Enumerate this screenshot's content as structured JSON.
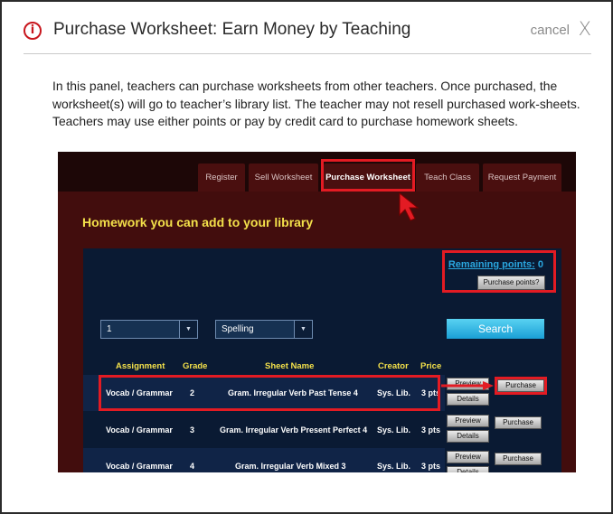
{
  "dialog": {
    "title": "Purchase Worksheet: Earn Money by Teaching",
    "cancel_label": "cancel",
    "close_glyph": "X",
    "info_glyph": "i",
    "description": "In this panel, teachers can purchase worksheets from other teachers. Once purchased, the worksheet(s) will go to teacher’s library list. The teacher may not resell purchased work-sheets. Teachers may use either points or pay by credit card to purchase homework sheets."
  },
  "screenshot": {
    "tabs": [
      {
        "label": "Register"
      },
      {
        "label": "Sell Worksheet"
      },
      {
        "label": "Purchase Worksheet",
        "active": true
      },
      {
        "label": "Teach Class"
      },
      {
        "label": "Request Payment"
      }
    ],
    "heading": "Homework you can add to your library",
    "remaining_label": "Remaining points:",
    "remaining_value": "0",
    "purchase_points_label": "Purchase points?",
    "grade_select_value": "1",
    "subject_select_value": "Spelling",
    "search_label": "Search",
    "columns": [
      "Assignment",
      "Grade",
      "Sheet Name",
      "Creator",
      "Price"
    ],
    "rows": [
      {
        "assignment": "Vocab / Grammar",
        "grade": "2",
        "sheet": "Gram. Irregular Verb Past Tense 4",
        "creator": "Sys. Lib.",
        "price": "3 pts"
      },
      {
        "assignment": "Vocab / Grammar",
        "grade": "3",
        "sheet": "Gram. Irregular Verb Present Perfect 4",
        "creator": "Sys. Lib.",
        "price": "3 pts"
      },
      {
        "assignment": "Vocab / Grammar",
        "grade": "4",
        "sheet": "Gram. Irregular Verb Mixed 3",
        "creator": "Sys. Lib.",
        "price": "3 pts"
      }
    ],
    "preview_label": "Preview",
    "details_label": "Details",
    "purchase_label": "Purchase"
  },
  "colors": {
    "accent_red": "#e31b23",
    "heading_yellow": "#f3e04a",
    "link_blue": "#2aa7e0"
  }
}
